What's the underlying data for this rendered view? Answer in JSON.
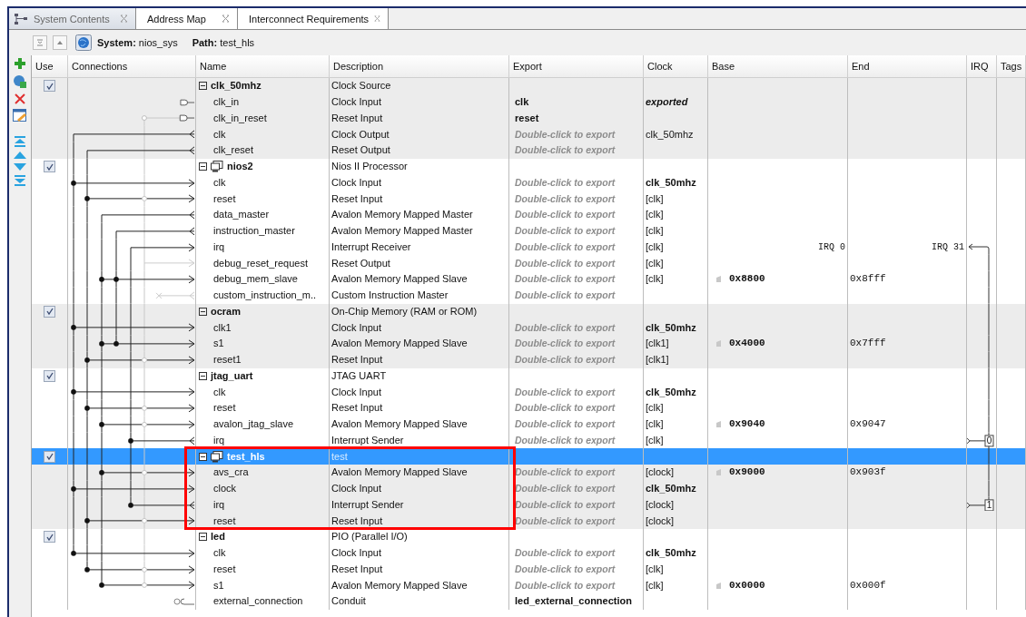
{
  "tabs": [
    {
      "label": "System Contents",
      "selected": true
    },
    {
      "label": "Address Map",
      "selected": false
    },
    {
      "label": "Interconnect Requirements",
      "selected": false
    }
  ],
  "toolbar": {
    "system_label": "System:",
    "system": "nios_sys",
    "path_label": "Path:",
    "path": "test_hls"
  },
  "table": {
    "columns": [
      "Use",
      "Connections",
      "Name",
      "Description",
      "Export",
      "Clock",
      "Base",
      "End",
      "IRQ",
      "Tags"
    ],
    "modules": [
      {
        "name": "clk_50mhz",
        "description": "Clock Source",
        "use": true,
        "expanded": true,
        "selected": false,
        "has_icon": false,
        "interfaces": [
          {
            "name": "clk_in",
            "description": "Clock Input",
            "export": "clk",
            "export_hint": false,
            "clock": "exported",
            "clock_bold": true,
            "clock_italic": true
          },
          {
            "name": "clk_in_reset",
            "description": "Reset Input",
            "export": "reset",
            "export_hint": false
          },
          {
            "name": "clk",
            "description": "Clock Output",
            "export": "Double-click to export",
            "export_hint": true,
            "clock": "clk_50mhz",
            "clock_bold": false,
            "clock_italic": false
          },
          {
            "name": "clk_reset",
            "description": "Reset Output",
            "export": "Double-click to export",
            "export_hint": true
          }
        ]
      },
      {
        "name": "nios2",
        "description": "Nios II Processor",
        "use": true,
        "expanded": true,
        "selected": false,
        "has_icon": true,
        "interfaces": [
          {
            "name": "clk",
            "description": "Clock Input",
            "export": "Double-click to export",
            "export_hint": true,
            "clock": "clk_50mhz",
            "clock_bold": true,
            "clock_italic": false
          },
          {
            "name": "reset",
            "description": "Reset Input",
            "export": "Double-click to export",
            "export_hint": true,
            "clock": "[clk]",
            "clock_bold": false,
            "clock_italic": false
          },
          {
            "name": "data_master",
            "description": "Avalon Memory Mapped Master",
            "export": "Double-click to export",
            "export_hint": true,
            "clock": "[clk]",
            "clock_bold": false,
            "clock_italic": false
          },
          {
            "name": "instruction_master",
            "description": "Avalon Memory Mapped Master",
            "export": "Double-click to export",
            "export_hint": true,
            "clock": "[clk]",
            "clock_bold": false,
            "clock_italic": false
          },
          {
            "name": "irq",
            "description": "Interrupt Receiver",
            "export": "Double-click to export",
            "export_hint": true,
            "clock": "[clk]",
            "clock_bold": false,
            "clock_italic": false,
            "irq_low": "IRQ 0",
            "irq_high": "IRQ 31"
          },
          {
            "name": "debug_reset_request",
            "description": "Reset Output",
            "export": "Double-click to export",
            "export_hint": true,
            "clock": "[clk]",
            "clock_bold": false,
            "clock_italic": false
          },
          {
            "name": "debug_mem_slave",
            "description": "Avalon Memory Mapped Slave",
            "export": "Double-click to export",
            "export_hint": true,
            "clock": "[clk]",
            "clock_bold": false,
            "clock_italic": false,
            "base": "0x8800",
            "end": "0x8fff"
          },
          {
            "name": "custom_instruction_m..",
            "description": "Custom Instruction Master",
            "export": "Double-click to export",
            "export_hint": true
          }
        ]
      },
      {
        "name": "ocram",
        "description": "On-Chip Memory (RAM or ROM)",
        "use": true,
        "expanded": true,
        "selected": false,
        "has_icon": false,
        "interfaces": [
          {
            "name": "clk1",
            "description": "Clock Input",
            "export": "Double-click to export",
            "export_hint": true,
            "clock": "clk_50mhz",
            "clock_bold": true,
            "clock_italic": false
          },
          {
            "name": "s1",
            "description": "Avalon Memory Mapped Slave",
            "export": "Double-click to export",
            "export_hint": true,
            "clock": "[clk1]",
            "clock_bold": false,
            "clock_italic": false,
            "base": "0x4000",
            "end": "0x7fff"
          },
          {
            "name": "reset1",
            "description": "Reset Input",
            "export": "Double-click to export",
            "export_hint": true,
            "clock": "[clk1]",
            "clock_bold": false,
            "clock_italic": false
          }
        ]
      },
      {
        "name": "jtag_uart",
        "description": "JTAG UART",
        "use": true,
        "expanded": true,
        "selected": false,
        "has_icon": false,
        "interfaces": [
          {
            "name": "clk",
            "description": "Clock Input",
            "export": "Double-click to export",
            "export_hint": true,
            "clock": "clk_50mhz",
            "clock_bold": true,
            "clock_italic": false
          },
          {
            "name": "reset",
            "description": "Reset Input",
            "export": "Double-click to export",
            "export_hint": true,
            "clock": "[clk]",
            "clock_bold": false,
            "clock_italic": false
          },
          {
            "name": "avalon_jtag_slave",
            "description": "Avalon Memory Mapped Slave",
            "export": "Double-click to export",
            "export_hint": true,
            "clock": "[clk]",
            "clock_bold": false,
            "clock_italic": false,
            "base": "0x9040",
            "end": "0x9047"
          },
          {
            "name": "irq",
            "description": "Interrupt Sender",
            "export": "Double-click to export",
            "export_hint": true,
            "clock": "[clk]",
            "clock_bold": false,
            "clock_italic": false,
            "irq": "0"
          }
        ]
      },
      {
        "name": "test_hls",
        "description": "test",
        "use": true,
        "expanded": true,
        "selected": true,
        "has_icon": true,
        "interfaces": [
          {
            "name": "avs_cra",
            "description": "Avalon Memory Mapped Slave",
            "export": "Double-click to export",
            "export_hint": true,
            "clock": "[clock]",
            "clock_bold": false,
            "clock_italic": false,
            "base": "0x9000",
            "end": "0x903f"
          },
          {
            "name": "clock",
            "description": "Clock Input",
            "export": "Double-click to export",
            "export_hint": true,
            "clock": "clk_50mhz",
            "clock_bold": true,
            "clock_italic": false
          },
          {
            "name": "irq",
            "description": "Interrupt Sender",
            "export": "Double-click to export",
            "export_hint": true,
            "clock": "[clock]",
            "clock_bold": false,
            "clock_italic": false,
            "irq": "1"
          },
          {
            "name": "reset",
            "description": "Reset Input",
            "export": "Double-click to export",
            "export_hint": true,
            "clock": "[clock]",
            "clock_bold": false,
            "clock_italic": false
          }
        ]
      },
      {
        "name": "led",
        "description": "PIO (Parallel I/O)",
        "use": true,
        "expanded": true,
        "selected": false,
        "has_icon": false,
        "interfaces": [
          {
            "name": "clk",
            "description": "Clock Input",
            "export": "Double-click to export",
            "export_hint": true,
            "clock": "clk_50mhz",
            "clock_bold": true,
            "clock_italic": false
          },
          {
            "name": "reset",
            "description": "Reset Input",
            "export": "Double-click to export",
            "export_hint": true,
            "clock": "[clk]",
            "clock_bold": false,
            "clock_italic": false
          },
          {
            "name": "s1",
            "description": "Avalon Memory Mapped Slave",
            "export": "Double-click to export",
            "export_hint": true,
            "clock": "[clk]",
            "clock_bold": false,
            "clock_italic": false,
            "base": "0x0000",
            "end": "0x000f"
          },
          {
            "name": "external_connection",
            "description": "Conduit",
            "export": "led_external_connection",
            "export_hint": false
          }
        ]
      }
    ]
  }
}
